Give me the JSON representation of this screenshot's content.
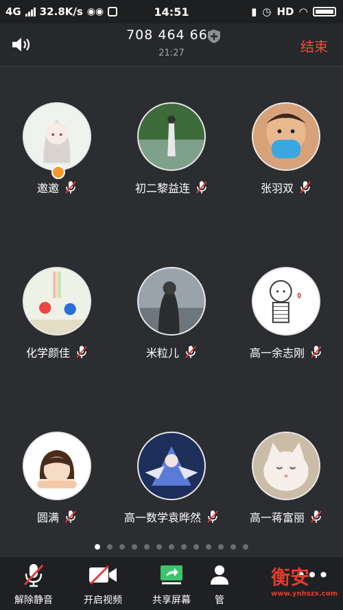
{
  "status_bar": {
    "network": "4G",
    "speed": "32.8K/s",
    "time": "14:51",
    "hd": "HD"
  },
  "header": {
    "meeting_id": "708 464 664",
    "duration": "21:27",
    "end_label": "结束"
  },
  "participants": [
    {
      "name": "邀邀",
      "avatar": "anime-girl",
      "muted": true,
      "host": true
    },
    {
      "name": "初二黎益连",
      "avatar": "lake-figure",
      "muted": true,
      "host": false
    },
    {
      "name": "张羽双",
      "avatar": "child-mask",
      "muted": true,
      "host": false
    },
    {
      "name": "化学颜佳",
      "avatar": "cartoon-rainbow",
      "muted": true,
      "host": false
    },
    {
      "name": "米粒儿",
      "avatar": "woman-sea",
      "muted": true,
      "host": false
    },
    {
      "name": "高一余志刚",
      "avatar": "sketch-boy",
      "muted": true,
      "host": false
    },
    {
      "name": "圆满",
      "avatar": "cartoon-sleep",
      "muted": true,
      "host": false
    },
    {
      "name": "高一数学袁晔然",
      "avatar": "anime-mecha",
      "muted": true,
      "host": false
    },
    {
      "name": "高一蒋富丽",
      "avatar": "cat",
      "muted": true,
      "host": false
    }
  ],
  "pager": {
    "count": 13,
    "active": 0
  },
  "toolbar": {
    "unmute": "解除静音",
    "video": "开启视频",
    "share": "共享屏幕",
    "manage": "管"
  },
  "watermark": {
    "main": "衡安",
    "sub": "www.ynhszx.com"
  },
  "colors": {
    "accent_red": "#f04a3c",
    "share_green": "#3cc46b",
    "badge_orange": "#f29a2e"
  }
}
